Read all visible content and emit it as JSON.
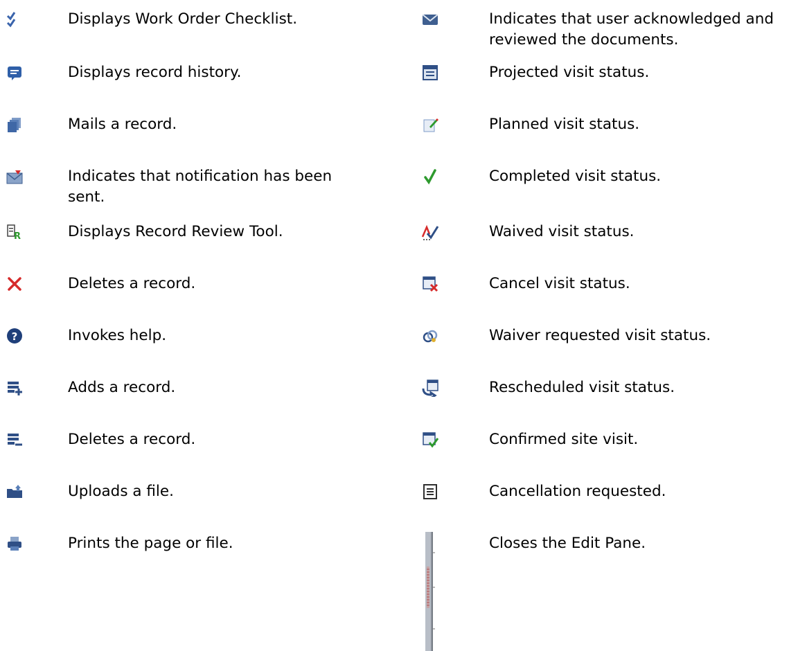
{
  "left_column": [
    {
      "icon": "checklist-icon",
      "text": "Displays Work Order Checklist."
    },
    {
      "icon": "record-history-icon",
      "text": "Displays record history."
    },
    {
      "icon": "mail-record-icon",
      "text": "Mails a record."
    },
    {
      "icon": "notification-sent-icon",
      "text": "Indicates that notification has been sent."
    },
    {
      "icon": "record-review-tool-icon",
      "text": "Displays Record Review Tool."
    },
    {
      "icon": "delete-x-icon",
      "text": "Deletes a record."
    },
    {
      "icon": "help-icon",
      "text": "Invokes help."
    },
    {
      "icon": "add-record-icon",
      "text": "Adds a record."
    },
    {
      "icon": "delete-record-icon",
      "text": "Deletes a record."
    },
    {
      "icon": "upload-file-icon",
      "text": "Uploads a file."
    },
    {
      "icon": "print-icon",
      "text": "Prints the page or file."
    }
  ],
  "right_column": [
    {
      "icon": "acknowledged-envelope-icon",
      "text": "Indicates that user acknowledged and reviewed the documents."
    },
    {
      "icon": "projected-visit-icon",
      "text": "Projected visit status."
    },
    {
      "icon": "planned-visit-icon",
      "text": "Planned visit status."
    },
    {
      "icon": "completed-visit-icon",
      "text": "Completed visit status."
    },
    {
      "icon": "waived-visit-icon",
      "text": "Waived visit status."
    },
    {
      "icon": "cancel-visit-icon",
      "text": "Cancel visit status."
    },
    {
      "icon": "waiver-requested-icon",
      "text": "Waiver requested visit status."
    },
    {
      "icon": "rescheduled-visit-icon",
      "text": "Rescheduled visit status."
    },
    {
      "icon": "confirmed-site-visit-icon",
      "text": "Confirmed site visit."
    },
    {
      "icon": "cancellation-requested-icon",
      "text": "Cancellation requested."
    },
    {
      "icon": "edit-pane-splitter-icon",
      "text": "Closes the Edit Pane."
    }
  ],
  "colors": {
    "text": "#000000",
    "blue_icon": "#2f5fa8",
    "red_icon": "#d62b2b",
    "green_icon": "#2e9a2e"
  }
}
